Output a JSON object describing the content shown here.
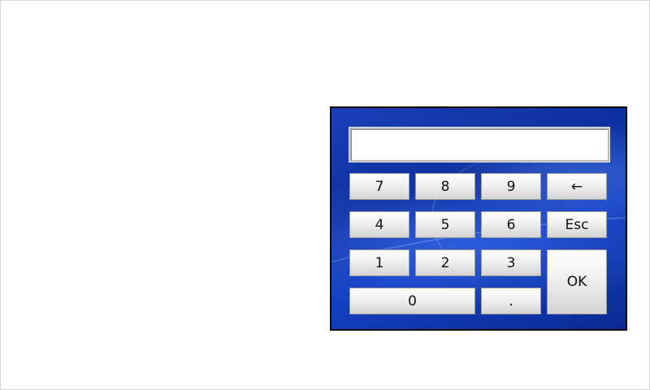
{
  "keypad": {
    "display_value": "",
    "keys": {
      "k7": "7",
      "k8": "8",
      "k9": "9",
      "backspace": "←",
      "k4": "4",
      "k5": "5",
      "k6": "6",
      "esc": "Esc",
      "k1": "1",
      "k2": "2",
      "k3": "3",
      "ok": "OK",
      "k0": "0",
      "dot": "."
    }
  }
}
